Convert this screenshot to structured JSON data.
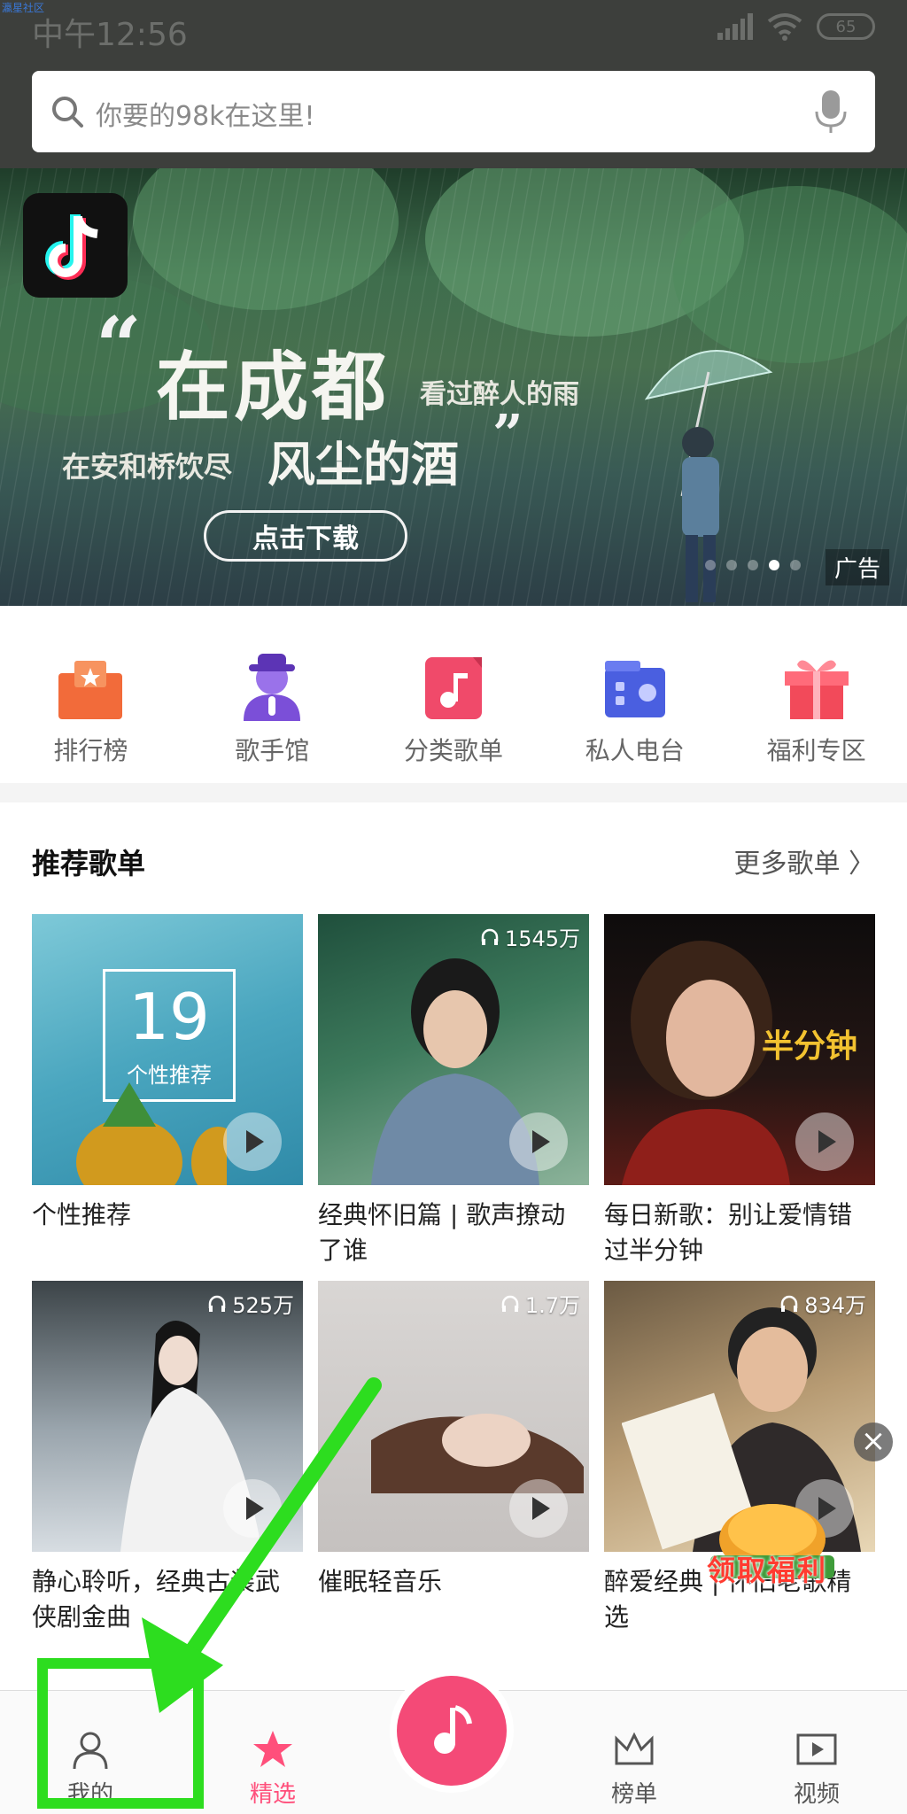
{
  "watermark": "瀛星社区",
  "status": {
    "time": "中午12:56",
    "battery": "65"
  },
  "search": {
    "placeholder": "你要的98k在这里!"
  },
  "banner": {
    "quote_open": "“",
    "line1": "在成都",
    "line1_small": "看过醉人的雨",
    "line2_small": "在安和桥饮尽",
    "line2": "风尘的酒",
    "quote_close": "”",
    "button": "点击下载",
    "ad_label": "广告",
    "dots_total": 5,
    "active_dot": 4
  },
  "categories": [
    {
      "label": "排行榜",
      "icon": "ranking-icon",
      "color": "#f26b3a"
    },
    {
      "label": "歌手馆",
      "icon": "singer-icon",
      "color": "#7b4fd8"
    },
    {
      "label": "分类歌单",
      "icon": "category-playlist-icon",
      "color": "#f04a6a"
    },
    {
      "label": "私人电台",
      "icon": "radio-icon",
      "color": "#4a5fe0"
    },
    {
      "label": "福利专区",
      "icon": "gift-icon",
      "color": "#f24a5a"
    }
  ],
  "section": {
    "title": "推荐歌单",
    "more": "更多歌单 〉"
  },
  "playlists": [
    {
      "title": "个性推荐",
      "plays": "",
      "badge_number": "19",
      "badge_text": "个性推荐"
    },
    {
      "title": "经典怀旧篇 | 歌声撩动了谁",
      "plays": "1545万"
    },
    {
      "title": "每日新歌：别让爱情错过半分钟",
      "plays": "",
      "overlay_text": "半分钟"
    },
    {
      "title": "静心聆听，经典古装武侠剧金曲",
      "plays": "525万"
    },
    {
      "title": "催眠轻音乐",
      "plays": "1.7万"
    },
    {
      "title": "醉爱经典 | 怀旧老歌精选",
      "plays": "834万"
    }
  ],
  "promo": {
    "text": "领取福利"
  },
  "close_symbol": "×",
  "nav": {
    "mine": "我的",
    "featured": "精选",
    "charts": "榜单",
    "video": "视频"
  },
  "colors": {
    "accent": "#f44a77",
    "highlight": "#2ddd1f"
  }
}
